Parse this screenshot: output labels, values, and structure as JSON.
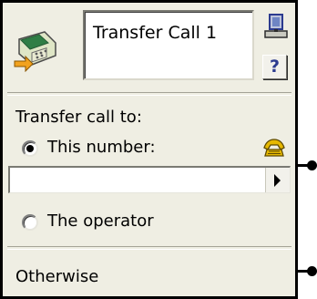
{
  "node": {
    "title": "Transfer Call 1",
    "help_label": "?",
    "icons": {
      "node_icon": "phone-transfer-icon",
      "computer_icon": "computer-icon",
      "dial_icon": "dial-phone-icon"
    }
  },
  "transfer": {
    "label": "Transfer call to:",
    "option_number": {
      "label": "This number:",
      "selected": true
    },
    "number_value": "",
    "option_operator": {
      "label": "The operator",
      "selected": false
    }
  },
  "otherwise": {
    "label": "Otherwise"
  },
  "colors": {
    "panel_bg": "#efeee3",
    "border": "#000000",
    "accent": "#2c3b8f",
    "icon_yellow": "#e6b800"
  }
}
